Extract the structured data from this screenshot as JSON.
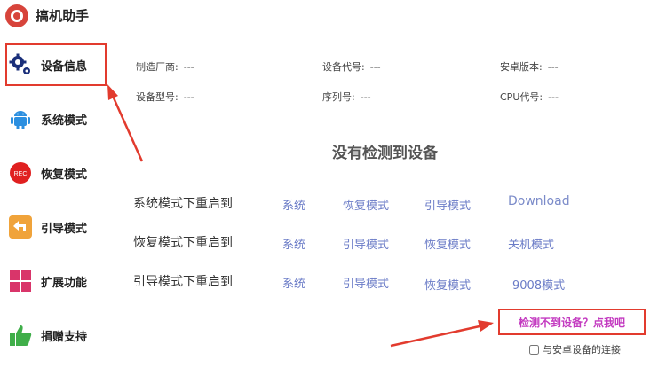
{
  "header": {
    "title": "搞机助手"
  },
  "sidebar": {
    "items": [
      {
        "label": "设备信息",
        "icon": "gears-icon"
      },
      {
        "label": "系统模式",
        "icon": "android-icon"
      },
      {
        "label": "恢复模式",
        "icon": "rec-icon",
        "badge": "REC"
      },
      {
        "label": "引导模式",
        "icon": "return-arrow-icon"
      },
      {
        "label": "扩展功能",
        "icon": "grid-icon"
      },
      {
        "label": "捐赠支持",
        "icon": "thumbs-up-icon"
      }
    ]
  },
  "device_info": {
    "manufacturer": {
      "label": "制造厂商:",
      "value": "---"
    },
    "code": {
      "label": "设备代号:",
      "value": "---"
    },
    "android": {
      "label": "安卓版本:",
      "value": "---"
    },
    "model": {
      "label": "设备型号:",
      "value": "---"
    },
    "serial": {
      "label": "序列号:",
      "value": "---"
    },
    "cpu": {
      "label": "CPU代号:",
      "value": "---"
    }
  },
  "status": "没有检测到设备",
  "reboot_rows": [
    {
      "label": "系统模式下重启到",
      "options": [
        "系统",
        "恢复模式",
        "引导模式",
        "Download"
      ]
    },
    {
      "label": "恢复模式下重启到",
      "options": [
        "系统",
        "引导模式",
        "恢复模式",
        "关机模式"
      ]
    },
    {
      "label": "引导模式下重启到",
      "options": [
        "系统",
        "引导模式",
        "恢复模式",
        "9008模式"
      ]
    }
  ],
  "help_link": "检测不到设备？点我吧",
  "checkbox_label": "与安卓设备的连接",
  "colors": {
    "accent_red": "#e23b2e",
    "link_blue": "#6b7cc7",
    "help_purple": "#c33ac0"
  }
}
